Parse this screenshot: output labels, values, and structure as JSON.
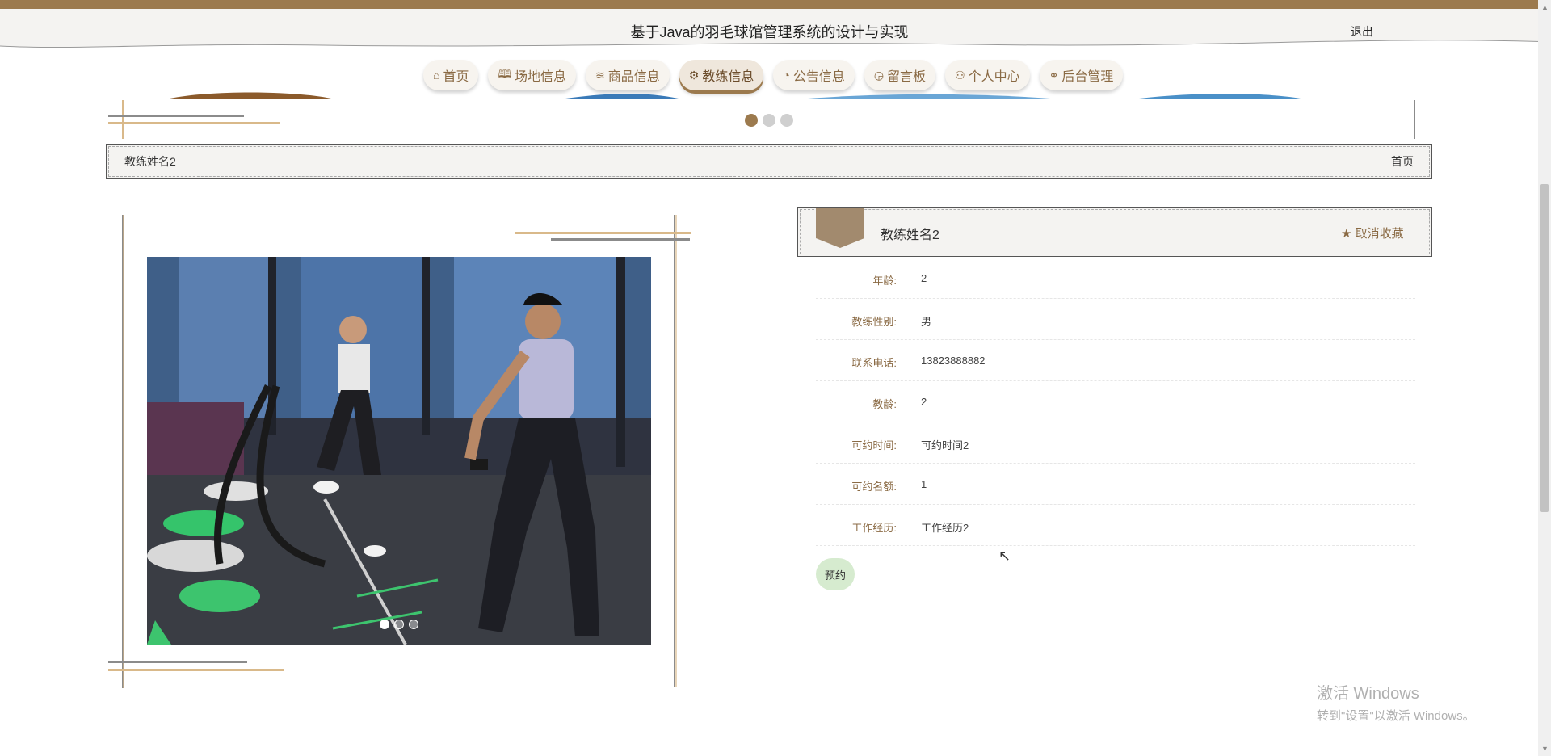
{
  "header": {
    "title": "基于Java的羽毛球馆管理系统的设计与实现",
    "logout": "退出"
  },
  "nav": {
    "items": [
      {
        "label": "首页",
        "icon": "home-icon",
        "glyph": "⌂"
      },
      {
        "label": "场地信息",
        "icon": "book-icon",
        "glyph": "🕮"
      },
      {
        "label": "商品信息",
        "icon": "layers-icon",
        "glyph": "≋"
      },
      {
        "label": "教练信息",
        "icon": "gear-icon",
        "glyph": "⚙"
      },
      {
        "label": "公告信息",
        "icon": "palette-icon",
        "glyph": "◔"
      },
      {
        "label": "留言板",
        "icon": "dashboard-icon",
        "glyph": "◶"
      },
      {
        "label": "个人中心",
        "icon": "user-icon",
        "glyph": "⚇"
      },
      {
        "label": "后台管理",
        "icon": "link-icon",
        "glyph": "⚭"
      }
    ],
    "active_index": 3
  },
  "banner": {
    "slide_count": 3,
    "active_slide": 0
  },
  "breadcrumb": {
    "current": "教练姓名2",
    "home": "首页"
  },
  "gallery": {
    "slide_count": 3,
    "active_slide": 0
  },
  "detail": {
    "title": "教练姓名2",
    "favorite_label": "取消收藏",
    "favorite_icon": "star-icon",
    "fields": [
      {
        "label": "年龄:",
        "value": "2"
      },
      {
        "label": "教练性别:",
        "value": "男"
      },
      {
        "label": "联系电话:",
        "value": "13823888882"
      },
      {
        "label": "教龄:",
        "value": "2"
      },
      {
        "label": "可约时间:",
        "value": "可约时间2"
      },
      {
        "label": "可约名额:",
        "value": "1"
      },
      {
        "label": "工作经历:",
        "value": "工作经历2"
      }
    ],
    "book_label": "预约"
  },
  "watermark": {
    "line1": "激活 Windows",
    "line2": "转到\"设置\"以激活 Windows。"
  },
  "colors": {
    "accent": "#9c7a4e",
    "nav_text": "#8a6a44",
    "book_button": "#d6ebcf"
  }
}
